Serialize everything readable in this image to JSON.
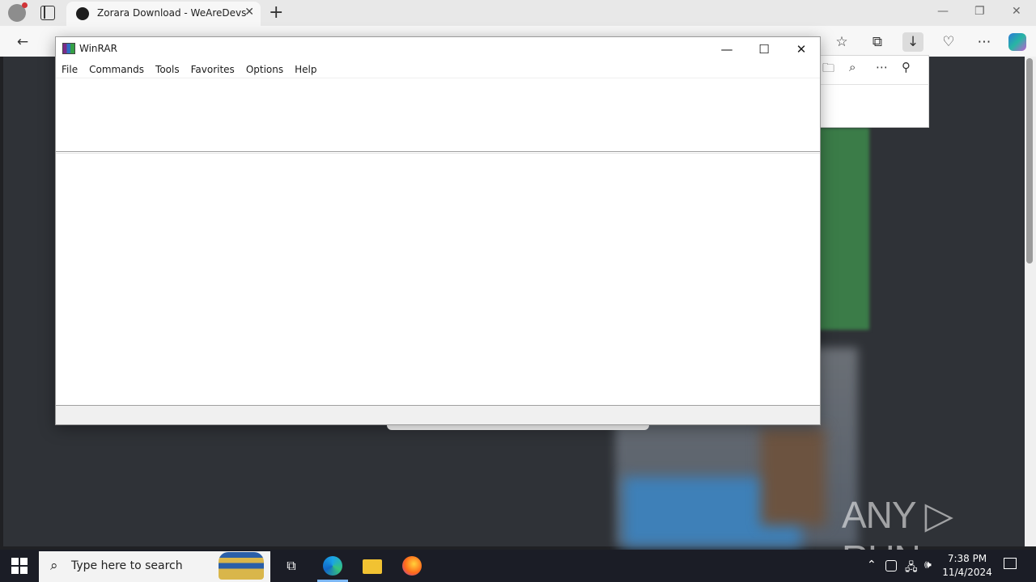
{
  "browser": {
    "tab_title": "Zorara Download - WeAreDevs",
    "tab_close": "✕",
    "new_tab": "+",
    "window_controls": {
      "minimize": "—",
      "restore": "❐",
      "close": "✕"
    },
    "toolbar_icons": {
      "back": "←",
      "favorites": "☆",
      "collections": "⧉",
      "downloads": "↓",
      "performance": "♡",
      "more": "⋯"
    }
  },
  "downloads_panel": {
    "folder": "🗀",
    "search": "⌕",
    "more": "⋯",
    "pin": "⚲"
  },
  "winrar": {
    "title": "WinRAR",
    "controls": {
      "minimize": "—",
      "maximize": "☐",
      "close": "✕"
    },
    "menu": [
      "File",
      "Commands",
      "Tools",
      "Favorites",
      "Options",
      "Help"
    ]
  },
  "watermark": "ANY ▷ RUN",
  "taskbar": {
    "search_placeholder": "Type here to search",
    "search_icon": "⌕",
    "task_view": "⧉",
    "tray_chevron": "⌃",
    "tray_network": "🖧",
    "tray_volume": "🕪",
    "time": "7:38 PM",
    "date": "11/4/2024"
  }
}
